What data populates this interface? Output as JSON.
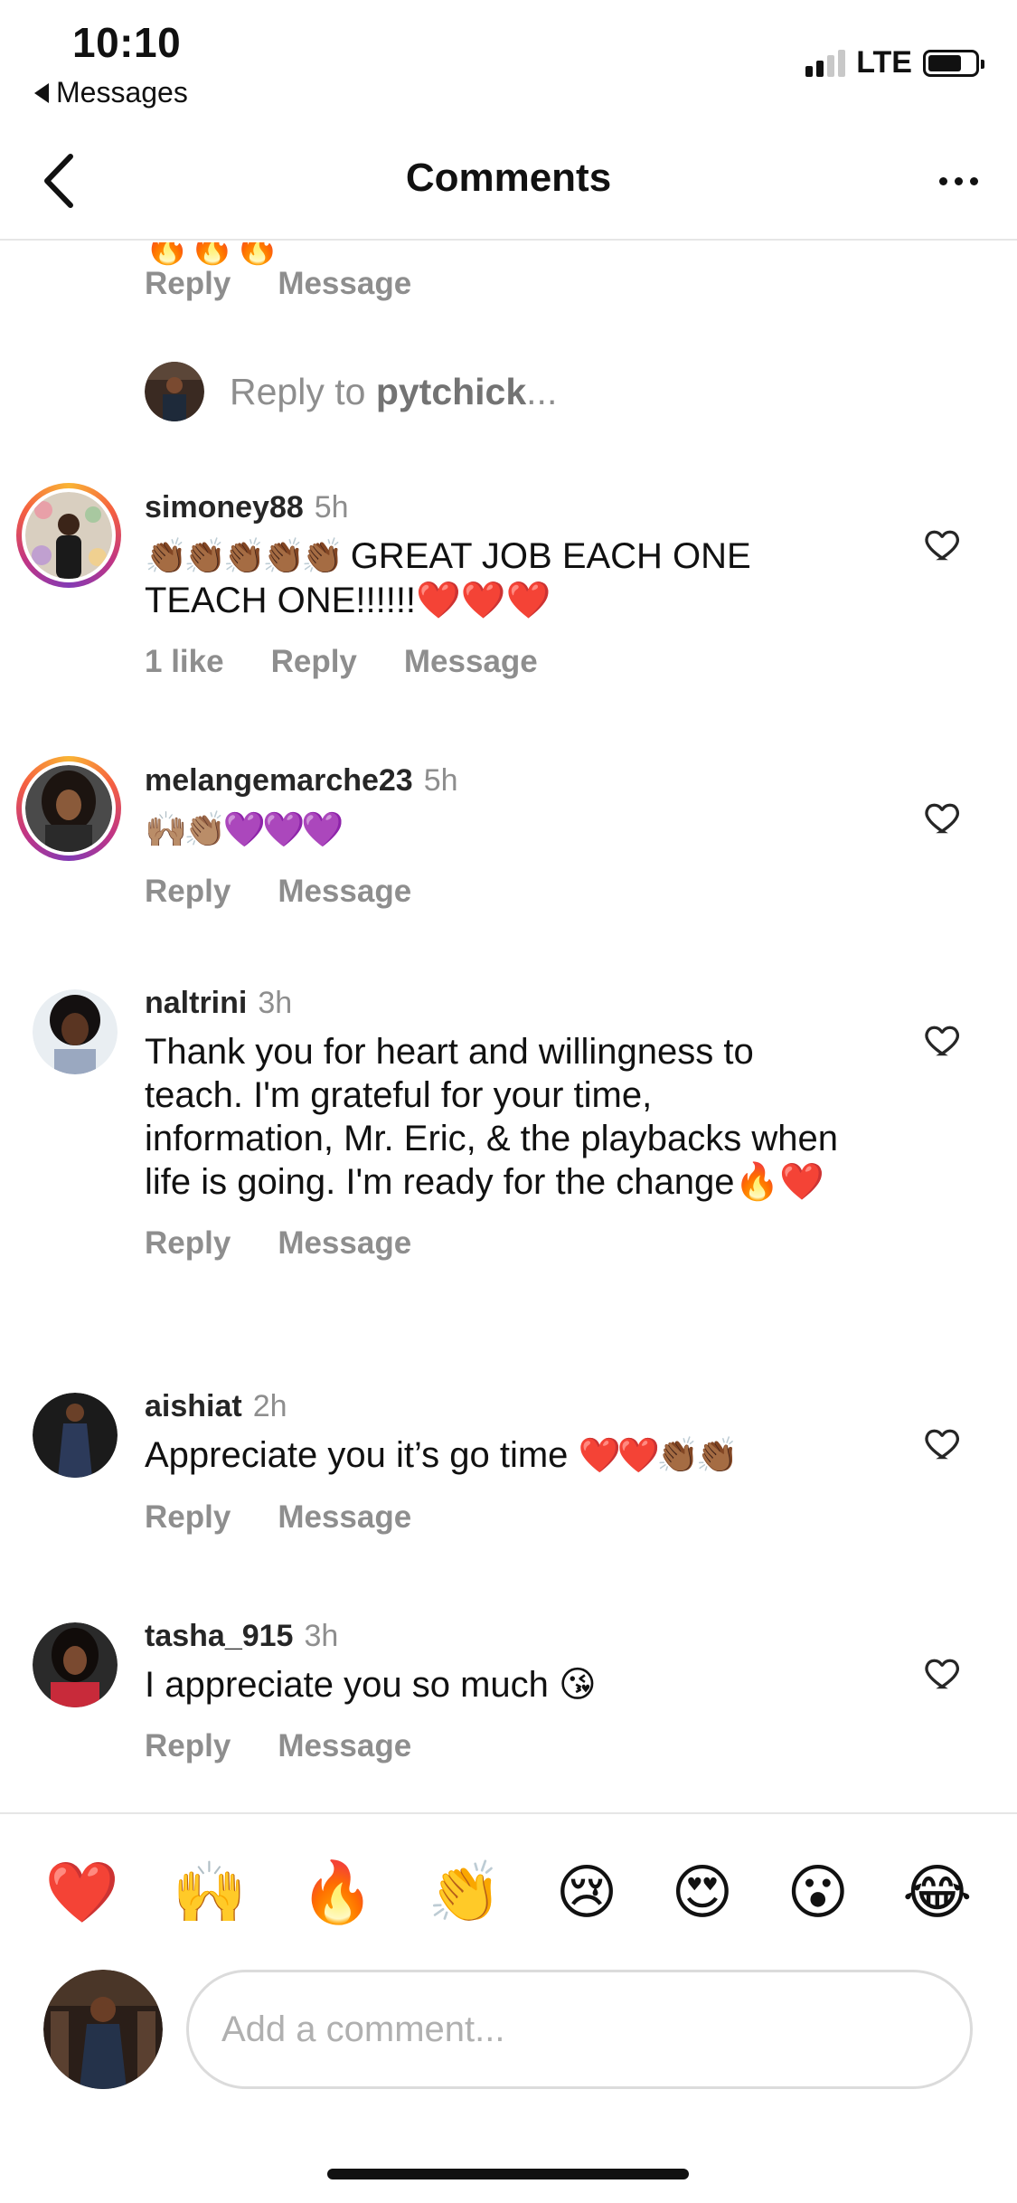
{
  "status_bar": {
    "time": "10:10",
    "back_app": "Messages",
    "network": "LTE",
    "battery_level": 0.72
  },
  "navbar": {
    "title": "Comments"
  },
  "partial_previous": {
    "emoji": "🔥🔥🔥",
    "reply_label": "Reply",
    "message_label": "Message"
  },
  "reply_to": {
    "prefix": "Reply to ",
    "username": "pytchick",
    "suffix": "..."
  },
  "comments": [
    {
      "username": "simoney88",
      "time": "5h",
      "text_emoji": "👏🏾👏🏾👏🏾👏🏾👏🏾",
      "text": " GREAT JOB EACH ONE TEACH ONE!!!!!!",
      "text_emoji_end": "❤️❤️❤️",
      "likes": "1 like",
      "reply_label": "Reply",
      "message_label": "Message",
      "story_ring": true
    },
    {
      "username": "melangemarche23",
      "time": "5h",
      "text_emoji": "🙌🏽👏🏽💜💜💜",
      "text": "",
      "reply_label": "Reply",
      "message_label": "Message",
      "story_ring": true
    },
    {
      "username": "naltrini",
      "time": "3h",
      "text": "Thank you for heart and willingness to teach. I'm grateful for your time, information, Mr. Eric, & the playbacks when life is going. I'm ready for the change",
      "text_emoji_end": "🔥❤️",
      "reply_label": "Reply",
      "message_label": "Message",
      "story_ring": false
    },
    {
      "username": "aishiat",
      "time": "2h",
      "text": "Appreciate you it’s go time ",
      "text_emoji_end": "❤️❤️👏🏾👏🏾",
      "reply_label": "Reply",
      "message_label": "Message",
      "story_ring": false
    },
    {
      "username": "tasha_915",
      "time": "3h",
      "text": "I appreciate you so much ",
      "text_emoji_end": "😘",
      "reply_label": "Reply",
      "message_label": "Message",
      "story_ring": false
    }
  ],
  "reactions": [
    "❤️",
    "🙌",
    "🔥",
    "👏",
    "😢",
    "😍",
    "😮",
    "😂"
  ],
  "composer": {
    "placeholder": "Add a comment..."
  },
  "colors": {
    "secondary_text": "#8e8e8e",
    "divider": "#e6e6e6",
    "story_ring_start": "#f9b434",
    "story_ring_end": "#c13584"
  }
}
